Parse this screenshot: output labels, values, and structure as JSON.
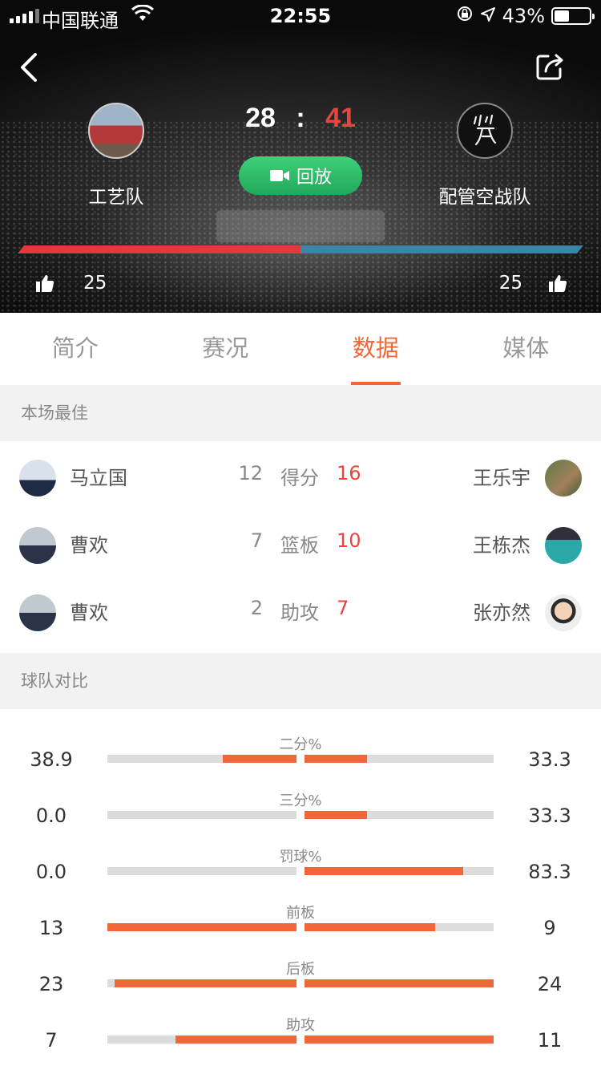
{
  "status_bar": {
    "carrier": "中国联通",
    "time": "22:55",
    "battery": "43%",
    "battery_level": 0.43
  },
  "header": {
    "home_team": {
      "name": "工艺队",
      "score": "28",
      "likes": "25"
    },
    "away_team": {
      "name": "配管空战队",
      "score": "41",
      "likes": "25"
    },
    "score_separator": ":",
    "replay_label": "回放",
    "vote_share_home": 0.5,
    "colors": {
      "home_bar": "#e23a3a",
      "away_bar": "#3a86a8",
      "away_score": "#e8463c",
      "replay": "#2bbd68"
    }
  },
  "tabs": [
    {
      "label": "简介",
      "active": false
    },
    {
      "label": "赛况",
      "active": false
    },
    {
      "label": "数据",
      "active": true
    },
    {
      "label": "媒体",
      "active": false
    }
  ],
  "best_players": {
    "title": "本场最佳",
    "rows": [
      {
        "left_name": "马立国",
        "left_value": "12",
        "stat": "得分",
        "right_value": "16",
        "right_name": "王乐宇"
      },
      {
        "left_name": "曹欢",
        "left_value": "7",
        "stat": "篮板",
        "right_value": "10",
        "right_name": "王栋杰"
      },
      {
        "left_name": "曹欢",
        "left_value": "2",
        "stat": "助攻",
        "right_value": "7",
        "right_name": "张亦然"
      }
    ]
  },
  "team_compare": {
    "title": "球队对比",
    "accent": "#f2673a",
    "rows": [
      {
        "label": "二分%",
        "left": "38.9",
        "right": "33.3",
        "left_fill": 0.39,
        "right_fill": 0.33
      },
      {
        "label": "三分%",
        "left": "0.0",
        "right": "33.3",
        "left_fill": 0.0,
        "right_fill": 0.33
      },
      {
        "label": "罚球%",
        "left": "0.0",
        "right": "83.3",
        "left_fill": 0.0,
        "right_fill": 0.84
      },
      {
        "label": "前板",
        "left": "13",
        "right": "9",
        "left_fill": 1.0,
        "right_fill": 0.69
      },
      {
        "label": "后板",
        "left": "23",
        "right": "24",
        "left_fill": 0.96,
        "right_fill": 1.0
      },
      {
        "label": "助攻",
        "left": "7",
        "right": "11",
        "left_fill": 0.64,
        "right_fill": 1.0
      }
    ]
  }
}
